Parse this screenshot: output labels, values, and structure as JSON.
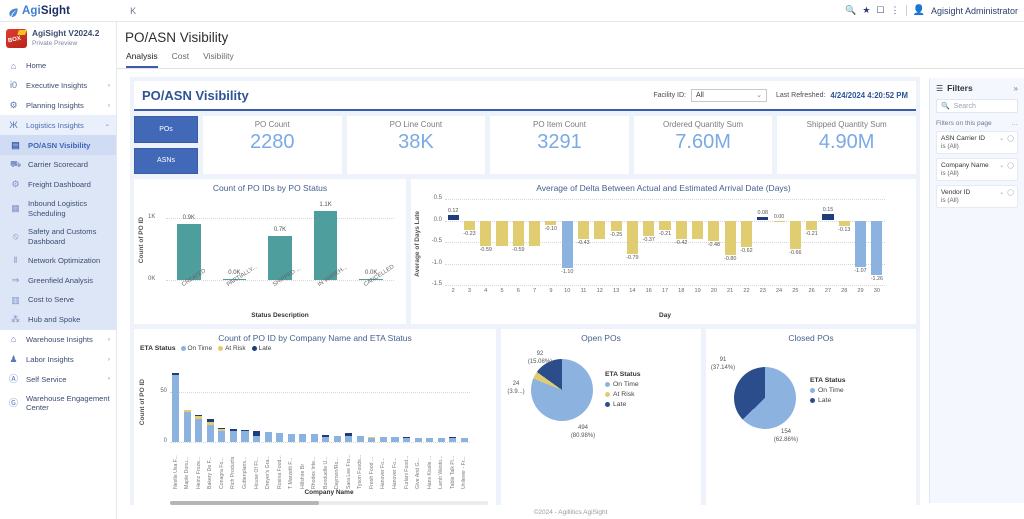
{
  "topbar": {
    "brand_lead": "Agi",
    "brand_tail": "Sight",
    "k_label": "K",
    "icons": [
      "search-icon",
      "star-icon",
      "bookmark-icon",
      "more-vertical-icon"
    ],
    "user": "Agisight Administrator"
  },
  "sidebar": {
    "product_title": "AgiSight V2024.2",
    "product_sub": "Private Preview",
    "items": [
      {
        "label": "Home",
        "icon": "home-icon",
        "type": "link"
      },
      {
        "label": "Executive Insights",
        "icon": "globe-icon",
        "type": "group",
        "chev": "›"
      },
      {
        "label": "Planning Insights",
        "icon": "gear-icon",
        "type": "group",
        "chev": "›"
      },
      {
        "label": "Logistics Insights",
        "icon": "binoculars-icon",
        "type": "group-open",
        "chev": "⌄"
      },
      {
        "label": "PO/ASN Visibility",
        "icon": "report-icon",
        "type": "sub-active"
      },
      {
        "label": "Carrier Scorecard",
        "icon": "truck-icon",
        "type": "sub"
      },
      {
        "label": "Freight Dashboard",
        "icon": "wheel-icon",
        "type": "sub"
      },
      {
        "label": "Inbound Logistics Scheduling",
        "icon": "calendar-icon",
        "type": "sub"
      },
      {
        "label": "Safety and Customs Dashboard",
        "icon": "prohibit-icon",
        "type": "sub"
      },
      {
        "label": "Network Optimization",
        "icon": "bars-icon",
        "type": "sub"
      },
      {
        "label": "Greenfield Analysis",
        "icon": "arrow-right-icon",
        "type": "sub"
      },
      {
        "label": "Cost to Serve",
        "icon": "document-icon",
        "type": "sub"
      },
      {
        "label": "Hub and Spoke",
        "icon": "hub-icon",
        "type": "sub"
      },
      {
        "label": "Warehouse Insights",
        "icon": "warehouse-icon",
        "type": "group",
        "chev": "›"
      },
      {
        "label": "Labor Insights",
        "icon": "people-icon",
        "type": "group",
        "chev": "›"
      },
      {
        "label": "Self Service",
        "icon": "person-circle-icon",
        "type": "group",
        "chev": "›"
      },
      {
        "label": "Warehouse Engagement Center",
        "icon": "engage-icon",
        "type": "link"
      }
    ]
  },
  "page": {
    "title": "PO/ASN Visibility",
    "tabs": [
      {
        "label": "Analysis",
        "active": true
      },
      {
        "label": "Cost",
        "active": false
      },
      {
        "label": "Visibility",
        "active": false
      }
    ]
  },
  "report": {
    "title": "PO/ASN Visibility",
    "facility_label": "Facility ID:",
    "facility_value": "All",
    "last_refreshed_label": "Last Refreshed:",
    "last_refreshed_value": "4/24/2024 4:20:52 PM",
    "toggle_buttons": [
      {
        "label": "POs"
      },
      {
        "label": "ASNs"
      }
    ],
    "kpis": [
      {
        "label": "PO Count",
        "value": "2280"
      },
      {
        "label": "PO Line Count",
        "value": "38K"
      },
      {
        "label": "PO Item Count",
        "value": "3291"
      },
      {
        "label": "Ordered Quantity Sum",
        "value": "7.60M"
      },
      {
        "label": "Shipped Quantity Sum",
        "value": "4.90M"
      }
    ]
  },
  "chart_data": [
    {
      "id": "po_status",
      "type": "bar",
      "title": "Count of PO IDs by PO Status",
      "xlabel": "Status Description",
      "ylabel": "Count of PO ID",
      "categories": [
        "CREATED",
        "PARTIALLY...",
        "SHIPPED ...",
        "IN WAREH...",
        "CANCELLED"
      ],
      "values": [
        900,
        0,
        700,
        1100,
        0
      ],
      "data_labels": [
        "0.9K",
        "0.0K",
        "0.7K",
        "1.1K",
        "0.0K"
      ],
      "ylim": [
        0,
        1200
      ],
      "yticks": [
        0,
        1000
      ],
      "ytick_labels": [
        "0K",
        "1K"
      ],
      "color": "#4f9e9e",
      "grid": true
    },
    {
      "id": "delta_arrival",
      "type": "bar",
      "title": "Average of Delta Between Actual and Estimated Arrival Date (Days)",
      "xlabel": "Day",
      "ylabel": "Average of Days Late",
      "categories": [
        "2",
        "3",
        "4",
        "5",
        "6",
        "7",
        "9",
        "10",
        "11",
        "12",
        "13",
        "14",
        "16",
        "17",
        "18",
        "19",
        "20",
        "21",
        "22",
        "23",
        "24",
        "25",
        "26",
        "27",
        "28",
        "29",
        "30"
      ],
      "values": [
        0.12,
        -0.23,
        -0.59,
        -0.59,
        -0.59,
        -0.59,
        -0.1,
        -1.1,
        -0.43,
        -0.43,
        -0.25,
        -0.79,
        -0.37,
        -0.21,
        -0.42,
        -0.42,
        -0.48,
        -0.8,
        -0.62,
        0.08,
        0.0,
        -0.66,
        -0.21,
        0.15,
        -0.13,
        -1.07,
        -1.26
      ],
      "data_labels": [
        "0.12",
        "-0.23",
        "-0.59",
        "",
        "-0.59",
        "",
        "-0.10",
        "-1.10",
        "-0.43",
        "",
        "-0.25",
        "-0.79",
        "-0.37",
        "-0.21",
        "-0.42",
        "",
        "-0.48",
        "-0.80",
        "-0.62",
        "0.08",
        "0.00",
        "-0.66",
        "-0.21",
        "0.15",
        "-0.13",
        "-1.07",
        "-1.26"
      ],
      "bar_colors": [
        "#1f3d7a",
        "#e0cd71",
        "#e0cd71",
        "#e0cd71",
        "#e0cd71",
        "#e0cd71",
        "#e0cd71",
        "#8cb3e0",
        "#e0cd71",
        "#e0cd71",
        "#e0cd71",
        "#e0cd71",
        "#e0cd71",
        "#e0cd71",
        "#e0cd71",
        "#e0cd71",
        "#e0cd71",
        "#e0cd71",
        "#e0cd71",
        "#1f3d7a",
        "#e0cd71",
        "#e0cd71",
        "#e0cd71",
        "#1f3d7a",
        "#e0cd71",
        "#8cb3e0",
        "#8cb3e0"
      ],
      "ylim": [
        -1.5,
        0.5
      ],
      "yticks": [
        0.5,
        0.0,
        -0.5,
        -1.0,
        -1.5
      ],
      "ytick_labels": [
        "0.5",
        "0.0",
        "-0.5",
        "-1.0",
        "-1.5"
      ],
      "grid": true
    },
    {
      "id": "company_eta",
      "type": "bar",
      "title": "Count of PO ID by Company Name and ETA Status",
      "xlabel": "Company Name",
      "ylabel": "Count of PO ID",
      "legend_title": "ETA Status",
      "legend": [
        {
          "label": "On Time",
          "color": "#8cb3e0"
        },
        {
          "label": "At Risk",
          "color": "#e0cd71"
        },
        {
          "label": "Late",
          "color": "#1f3d7a"
        }
      ],
      "stacked": true,
      "ylim": [
        0,
        75
      ],
      "yticks": [
        0,
        50
      ],
      "ytick_labels": [
        "0",
        "50"
      ],
      "categories": [
        "Nestle Usa F...",
        "Maple Donu...",
        "Heinz Froze...",
        "Bakery De F...",
        "Conagra Fo...",
        "Rich Products",
        "Guttenplans...",
        "House Of Fl...",
        "Dreyer's Gra...",
        "Rosina Food...",
        "T Marzetti F...",
        "Hillshire Br",
        "Rhodes Inte...",
        "Bonduelle U...",
        "Daymon/Ro...",
        "Sara Lee Fro...",
        "Tyson Foods...",
        "Fresh Food ...",
        "Hanover Fo...",
        "Hanover Fo...",
        "Furlani Food...",
        "Give And G...",
        "Hans Kissle ...",
        "Lamb Westo...",
        "Table Talk Pi...",
        "Unilever - Fr..."
      ],
      "series": [
        {
          "name": "On Time",
          "values": [
            67,
            30,
            23,
            17,
            11,
            11,
            11,
            6,
            10,
            9,
            8,
            8,
            8,
            5,
            6,
            6,
            6,
            4,
            5,
            5,
            4,
            4,
            4,
            4,
            4,
            4
          ]
        },
        {
          "name": "At Risk",
          "values": [
            0,
            2,
            3,
            3,
            2,
            0,
            0,
            0,
            0,
            0,
            0,
            0,
            0,
            0,
            0,
            0,
            0,
            1,
            0,
            0,
            0,
            0,
            0,
            0,
            0,
            0
          ]
        },
        {
          "name": "Late",
          "values": [
            2,
            0,
            1,
            3,
            1,
            2,
            1,
            5,
            0,
            0,
            0,
            0,
            0,
            2,
            0,
            3,
            0,
            0,
            0,
            0,
            1,
            0,
            0,
            0,
            1,
            0
          ]
        }
      ],
      "grid": true
    },
    {
      "id": "open_pos",
      "type": "pie",
      "title": "Open POs",
      "legend_title": "ETA Status",
      "labels": [
        "On Time",
        "At Risk",
        "Late"
      ],
      "values": [
        494,
        24,
        92
      ],
      "percents": [
        "80.98%",
        "3.9...",
        "15.08%"
      ],
      "data_labels": [
        "494\n(80.98%)",
        "24\n(3.9...)",
        "92\n(15.08%)"
      ],
      "colors": [
        "#8cb3e0",
        "#e0cd71",
        "#2b4d8c"
      ]
    },
    {
      "id": "closed_pos",
      "type": "pie",
      "title": "Closed POs",
      "legend_title": "ETA Status",
      "labels": [
        "On Time",
        "Late"
      ],
      "values": [
        154,
        91
      ],
      "percents": [
        "62.86%",
        "37.14%"
      ],
      "data_labels": [
        "154\n(62.86%)",
        "91\n(37.14%)"
      ],
      "colors": [
        "#8cb3e0",
        "#2b4d8c"
      ]
    }
  ],
  "filters_pane": {
    "title": "Filters",
    "expand_icon": "»",
    "search_placeholder": "Search",
    "section_label": "Filters on this page",
    "items": [
      {
        "name": "ASN Carrier ID",
        "value": "is (All)"
      },
      {
        "name": "Company Name",
        "value": "is (All)"
      },
      {
        "name": "Vendor ID",
        "value": "is (All)"
      }
    ]
  },
  "footer": {
    "text": "©2024 - Agillitics AgiSight"
  }
}
